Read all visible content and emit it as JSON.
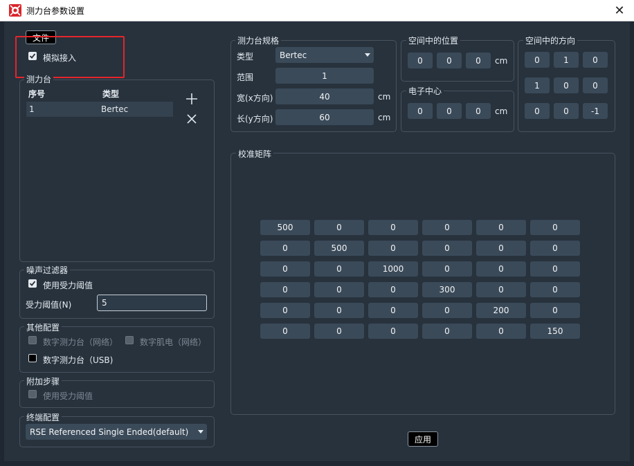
{
  "window": {
    "title": "测力台参数设置",
    "close": "✕"
  },
  "menu": {
    "file": "文件",
    "simulate_label": "模拟接入"
  },
  "plates": {
    "legend": "测力台",
    "col_index": "序号",
    "col_type": "类型",
    "rows": [
      {
        "index": "1",
        "type": "Bertec"
      }
    ],
    "add": "+",
    "remove": "✕"
  },
  "noise": {
    "legend": "噪声过滤器",
    "use_threshold": "使用受力阈值",
    "threshold_label": "受力阈值(N)",
    "threshold_value": "5"
  },
  "other": {
    "legend": "其他配置",
    "digital_plate_net": "数字测力台（网络）",
    "digital_emg_net": "数字肌电（网络）",
    "digital_plate_usb": "数字测力台（USB)"
  },
  "extra": {
    "legend": "附加步骤",
    "use_threshold": "使用受力阈值"
  },
  "terminal": {
    "legend": "终端配置",
    "selected": "RSE Referenced Single Ended(default)"
  },
  "spec": {
    "legend": "测力台规格",
    "type_label": "类型",
    "type_value": "Bertec",
    "range_label": "范围",
    "range_value": "1",
    "width_label": "宽(x方向)",
    "width_value": "40",
    "width_unit": "cm",
    "length_label": "长(y方向)",
    "length_value": "60",
    "length_unit": "cm"
  },
  "position": {
    "legend": "空间中的位置",
    "values": [
      "0",
      "0",
      "0"
    ],
    "unit": "cm"
  },
  "center": {
    "legend": "电子中心",
    "values": [
      "0",
      "0",
      "0"
    ],
    "unit": "cm"
  },
  "orientation": {
    "legend": "空间中的方向",
    "rows": [
      [
        "0",
        "1",
        "0"
      ],
      [
        "1",
        "0",
        "0"
      ],
      [
        "0",
        "0",
        "-1"
      ]
    ]
  },
  "calibration": {
    "legend": "校准矩阵",
    "rows": [
      [
        "500",
        "0",
        "0",
        "0",
        "0",
        "0"
      ],
      [
        "0",
        "500",
        "0",
        "0",
        "0",
        "0"
      ],
      [
        "0",
        "0",
        "1000",
        "0",
        "0",
        "0"
      ],
      [
        "0",
        "0",
        "0",
        "300",
        "0",
        "0"
      ],
      [
        "0",
        "0",
        "0",
        "0",
        "200",
        "0"
      ],
      [
        "0",
        "0",
        "0",
        "0",
        "0",
        "150"
      ]
    ]
  },
  "apply": "应用",
  "colors": {
    "background": "#27323d",
    "field": "#3b4a59",
    "highlight": "#e5252a",
    "border": "#48535f"
  }
}
